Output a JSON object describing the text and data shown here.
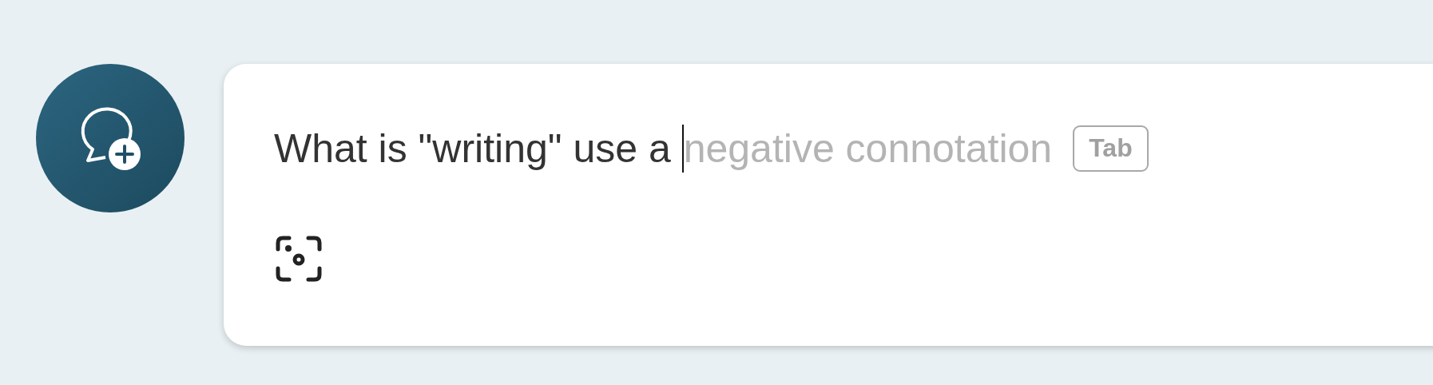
{
  "new_chat_button": {
    "kind": "chat-plus"
  },
  "input": {
    "value": "What is \"writing\" use a ",
    "suggestion": "negative connotation",
    "suggestion_key": "Tab",
    "focused": true
  },
  "toolbar": [
    {
      "kind": "scan"
    }
  ]
}
